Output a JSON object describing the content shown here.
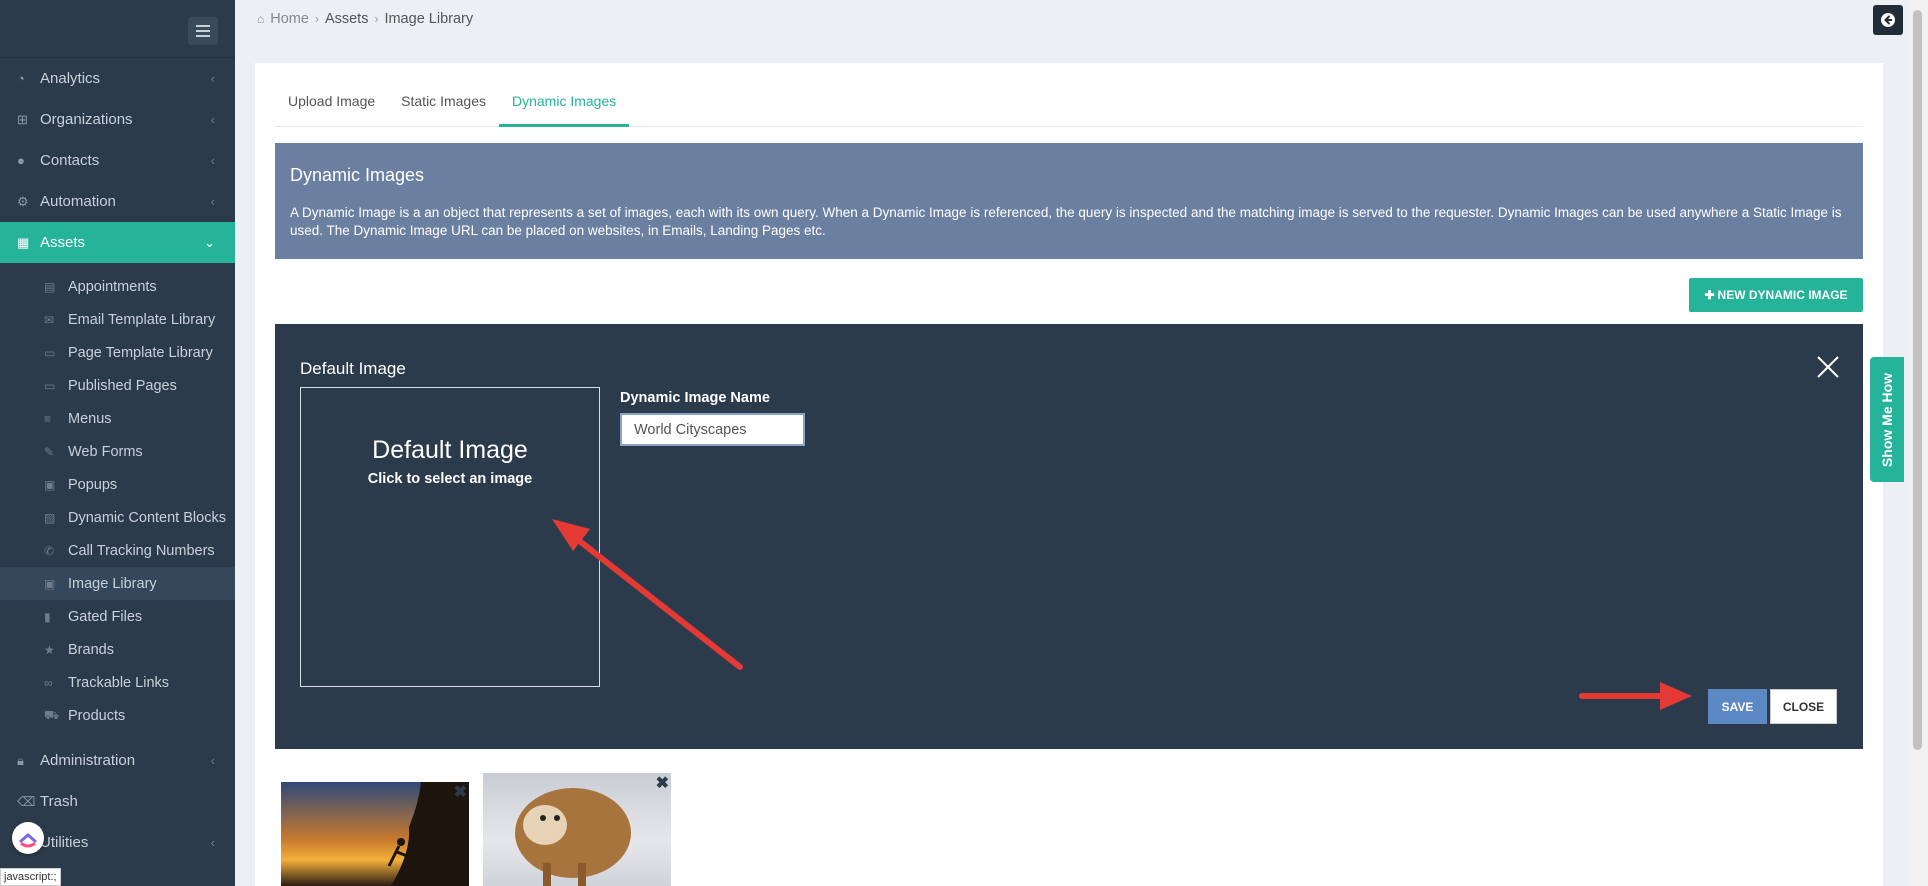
{
  "sidebar": {
    "nav": [
      {
        "label": "Analytics",
        "icon": "dashboard-icon"
      },
      {
        "label": "Organizations",
        "icon": "sitemap-icon"
      },
      {
        "label": "Contacts",
        "icon": "users-icon"
      },
      {
        "label": "Automation",
        "icon": "cogs-icon"
      },
      {
        "label": "Assets",
        "icon": "grid-icon"
      }
    ],
    "assets_items": [
      {
        "label": "Appointments",
        "icon": "calendar-icon"
      },
      {
        "label": "Email Template Library",
        "icon": "envelope-icon"
      },
      {
        "label": "Page Template Library",
        "icon": "page-icon"
      },
      {
        "label": "Published Pages",
        "icon": "page-icon"
      },
      {
        "label": "Menus",
        "icon": "list-icon"
      },
      {
        "label": "Web Forms",
        "icon": "edit-icon"
      },
      {
        "label": "Popups",
        "icon": "popup-icon"
      },
      {
        "label": "Dynamic Content Blocks",
        "icon": "blocks-icon"
      },
      {
        "label": "Call Tracking Numbers",
        "icon": "phone-icon"
      },
      {
        "label": "Image Library",
        "icon": "image-icon"
      },
      {
        "label": "Gated Files",
        "icon": "file-icon"
      },
      {
        "label": "Brands",
        "icon": "star-icon"
      },
      {
        "label": "Trackable Links",
        "icon": "link-icon"
      },
      {
        "label": "Products",
        "icon": "cart-icon"
      }
    ],
    "bottom": [
      {
        "label": "Administration",
        "icon": "lock-icon"
      },
      {
        "label": "Trash",
        "icon": "trash-icon"
      },
      {
        "label": "Utilities",
        "icon": "wrench-icon"
      }
    ],
    "status_text": "javascript:;"
  },
  "breadcrumb": {
    "home": "Home",
    "assets": "Assets",
    "current": "Image Library"
  },
  "tabs": [
    "Upload Image",
    "Static Images",
    "Dynamic Images"
  ],
  "info": {
    "title": "Dynamic Images",
    "body": "A Dynamic Image is a an object that represents a set of images, each with its own query. When a Dynamic Image is referenced, the query is inspected and the matching image is served to the requester. Dynamic Images can be used anywhere a Static Image is used. The Dynamic Image URL can be placed on websites, in Emails, Landing Pages etc."
  },
  "new_button": "NEW DYNAMIC IMAGE",
  "editor": {
    "title": "Default Image",
    "dropbox_title": "Default Image",
    "dropbox_hint": "Click to select an image",
    "name_label": "Dynamic Image Name",
    "name_value": "World Cityscapes",
    "save": "SAVE",
    "close": "CLOSE"
  },
  "show_me_how": "Show Me How",
  "colors": {
    "sidebar_bg": "#2c3b4b",
    "accent": "#25b39a",
    "info_bg": "#6b80a0",
    "save_bg": "#5c88c4",
    "arrow": "#e53935"
  }
}
